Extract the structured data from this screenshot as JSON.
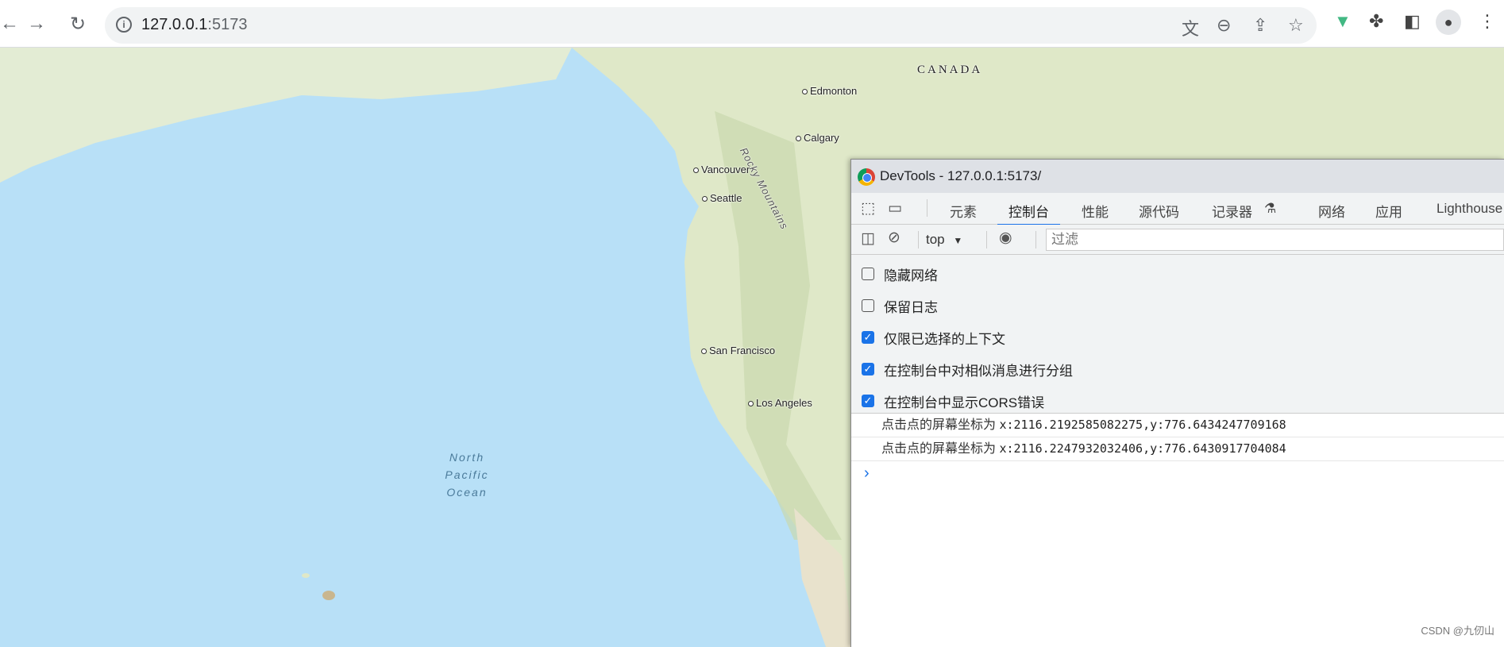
{
  "browser": {
    "url_host": "127.0.0.1",
    "url_port": ":5173",
    "icons": [
      "back-icon",
      "forward-icon",
      "reload-icon",
      "info-icon",
      "translate-icon",
      "zoom-out-icon",
      "share-icon",
      "star-icon",
      "vue-devtools-icon",
      "extensions-icon",
      "side-panel-icon",
      "profile-icon",
      "menu-icon"
    ]
  },
  "map": {
    "labels": {
      "canada": "CANADA",
      "edmonton": "Edmonton",
      "calgary": "Calgary",
      "vancouver": "Vancouver",
      "seattle": "Seattle",
      "san_francisco": "San Francisco",
      "los_angeles": "Los Angeles",
      "rocky": "Rocky Mountains",
      "ocean1": "North",
      "ocean2": "Pacific",
      "ocean3": "Ocean"
    }
  },
  "devtools": {
    "title": "DevTools - 127.0.0.1:5173/",
    "tabs": [
      "元素",
      "控制台",
      "性能",
      "源代码",
      "记录器",
      "网络",
      "应用",
      "Lighthouse"
    ],
    "active_tab": "控制台",
    "context": "top",
    "filter_placeholder": "过滤",
    "settings": [
      {
        "label": "隐藏网络",
        "checked": false
      },
      {
        "label": "保留日志",
        "checked": false
      },
      {
        "label": "仅限已选择的上下文",
        "checked": true
      },
      {
        "label": "在控制台中对相似消息进行分组",
        "checked": true
      },
      {
        "label": "在控制台中显示CORS错误",
        "checked": true
      }
    ],
    "messages": [
      {
        "prefix": "点击点的屏幕坐标为",
        "value": "x:2116.2192585082275,y:776.6434247709168"
      },
      {
        "prefix": "点击点的屏幕坐标为",
        "value": "x:2116.2247932032406,y:776.6430917704084"
      }
    ],
    "prompt": "›"
  },
  "watermark": "CSDN @九仞山",
  "colors": {
    "ocean": "#b8e0f7",
    "land": "#dfe8c8",
    "accent": "#1a73e8"
  }
}
